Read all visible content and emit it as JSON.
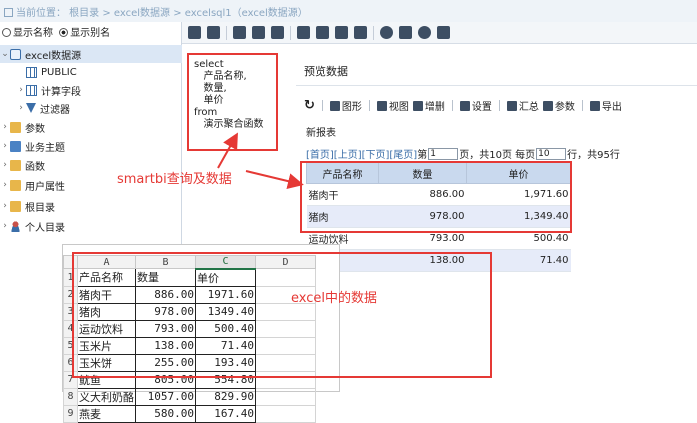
{
  "breadcrumb": "当前位置：  根目录 > excel数据源 > excelsql1（excel数据源）",
  "left_panel": {
    "radio_name": "显示名称",
    "radio_alias": "显示别名",
    "tree": [
      {
        "label": "excel数据源",
        "icon": "database-icon"
      },
      {
        "label": "PUBLIC",
        "icon": "schema-icon"
      },
      {
        "label": "计算字段",
        "icon": "calc-field-icon"
      },
      {
        "label": "过滤器",
        "icon": "filter-icon"
      },
      {
        "label": "参数",
        "icon": "param-icon"
      },
      {
        "label": "业务主题",
        "icon": "topic-icon"
      },
      {
        "label": "函数",
        "icon": "function-icon"
      },
      {
        "label": "用户属性",
        "icon": "user-attr-icon"
      },
      {
        "label": "根目录",
        "icon": "folder-icon"
      },
      {
        "label": "个人目录",
        "icon": "person-icon"
      }
    ]
  },
  "sql": "select\n   产品名称,\n   数量,\n   单价\nfrom\n   演示聚合函数",
  "preview": {
    "title": "预览数据",
    "toolbar": [
      "图形",
      "视图",
      "增删",
      "设置",
      "汇总",
      "参数",
      "导出"
    ],
    "report_name": "新报表",
    "pager": {
      "links": "[首页][上页][下页][尾页]",
      "page_label": "第",
      "page_value": "1",
      "total_pages": "页，共10页 每页",
      "per_page": "10",
      "total_rows": "行，共95行"
    },
    "headers": [
      "产品名称",
      "数量",
      "单价"
    ],
    "rows": [
      [
        "猪肉干",
        "886.00",
        "1,971.60"
      ],
      [
        "猪肉",
        "978.00",
        "1,349.40"
      ],
      [
        "运动饮料",
        "793.00",
        "500.40"
      ],
      [
        "",
        "138.00",
        "71.40"
      ]
    ]
  },
  "excel": {
    "columns": [
      "A",
      "B",
      "C",
      "D"
    ],
    "rows": [
      [
        "1",
        "产品名称",
        "数量",
        "单价"
      ],
      [
        "2",
        "猪肉干",
        "886.00",
        "1971.60"
      ],
      [
        "3",
        "猪肉",
        "978.00",
        "1349.40"
      ],
      [
        "4",
        "运动饮料",
        "793.00",
        "500.40"
      ],
      [
        "5",
        "玉米片",
        "138.00",
        "71.40"
      ],
      [
        "6",
        "玉米饼",
        "255.00",
        "193.40"
      ],
      [
        "7",
        "鱿鱼",
        "805.00",
        "554.80"
      ],
      [
        "8",
        "义大利奶酪",
        "1057.00",
        "829.90"
      ],
      [
        "9",
        "燕麦",
        "580.00",
        "167.40"
      ]
    ]
  },
  "annotations": {
    "smartbi": "smartbi查询及数据",
    "excel": "excel中的数据"
  },
  "colors": {
    "annotation_red": "#e53935",
    "header_blue": "#c9d9ee",
    "link_blue": "#3b6ea8"
  }
}
